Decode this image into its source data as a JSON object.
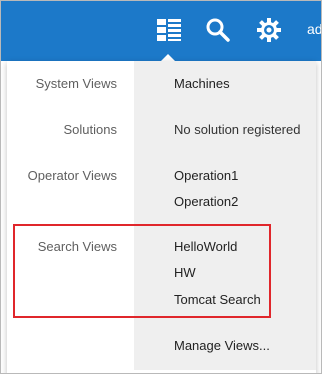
{
  "header": {
    "user_label": "ad",
    "icons": [
      "views-grid-icon",
      "search-icon",
      "gear-icon"
    ]
  },
  "menu": {
    "sections": [
      {
        "label": "System Views",
        "items": [
          "Machines"
        ]
      },
      {
        "label": "Solutions",
        "items": [
          "No solution registered"
        ]
      },
      {
        "label": "Operator Views",
        "items": [
          "Operation1",
          "Operation2"
        ]
      },
      {
        "label": "Search Views",
        "items": [
          "HelloWorld",
          "HW",
          "Tomcat Search"
        ]
      }
    ],
    "manage": "Manage Views..."
  },
  "colors": {
    "topbar": "#1c79c9",
    "menu_right_bg": "#efefef",
    "highlight": "#e0262b"
  }
}
